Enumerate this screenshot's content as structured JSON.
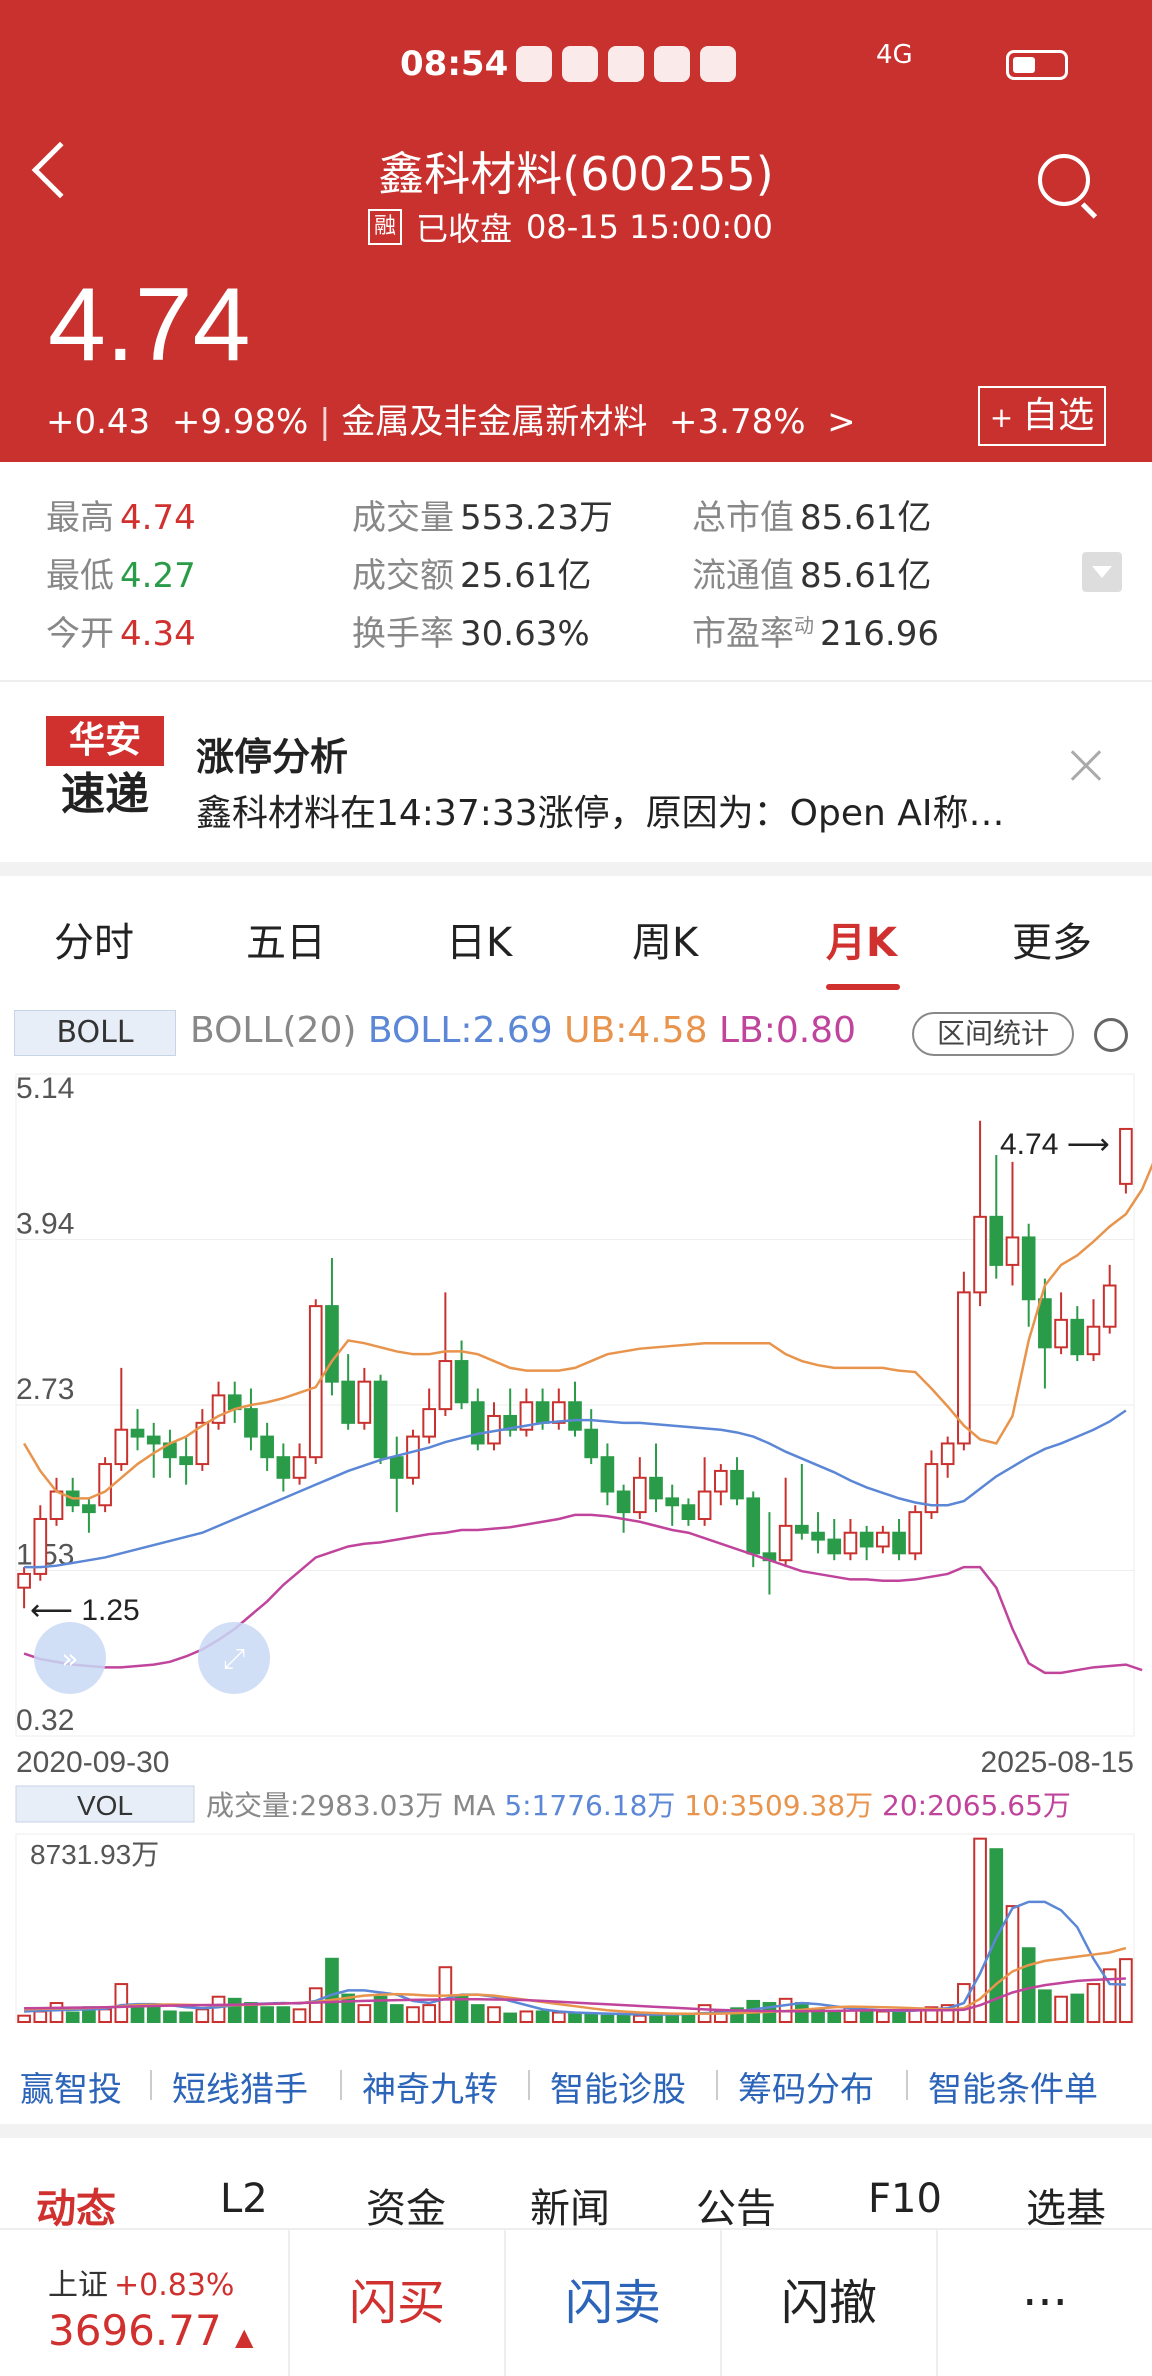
{
  "status_bar": {
    "time": "08:54",
    "net": "4G"
  },
  "header": {
    "title": "鑫科材料(600255)",
    "tag": "融",
    "status": "已收盘",
    "datetime": "08-15 15:00:00",
    "price": "4.74",
    "change": "+0.43",
    "change_pct": "+9.98%",
    "sector": "金属及非金属新材料",
    "sector_pct": "+3.78%",
    "add_label": "自选",
    "colors": {
      "bg": "#c8312e"
    }
  },
  "stats": {
    "high_label": "最高",
    "high": "4.74",
    "low_label": "最低",
    "low": "4.27",
    "open_label": "今开",
    "open": "4.34",
    "vol_label": "成交量",
    "vol": "553.23万",
    "amt_label": "成交额",
    "amt": "25.61亿",
    "turn_label": "换手率",
    "turn": "30.63%",
    "mcap_label": "总市值",
    "mcap": "85.61亿",
    "float_label": "流通值",
    "float": "85.61亿",
    "pe_label": "市盈率",
    "pe_sup": "动",
    "pe": "216.96"
  },
  "news": {
    "logo_top": "华安",
    "logo_bottom": "速递",
    "title": "涨停分析",
    "body": "鑫科材料在14:37:33涨停，原因为：Open AI称…"
  },
  "tabs": [
    "分时",
    "五日",
    "日K",
    "周K",
    "月K",
    "更多"
  ],
  "active_tab": "月K",
  "indicator": {
    "tag": "BOLL",
    "name": "BOLL(20)",
    "boll": "BOLL:2.69",
    "ub": "UB:4.58",
    "lb": "LB:0.80",
    "range_button": "区间统计"
  },
  "chart_data": {
    "type": "candlestick",
    "y_ticks": [
      "5.14",
      "3.94",
      "2.73",
      "1.53",
      "0.32"
    ],
    "ylim": [
      0.32,
      5.14
    ],
    "x_start": "2020-09-30",
    "x_end": "2025-08-15",
    "last_label": "4.74",
    "low_label": "1.25",
    "candles": [
      [
        1.4,
        1.5,
        1.55,
        1.25
      ],
      [
        1.5,
        1.9,
        2.0,
        1.45
      ],
      [
        1.9,
        2.1,
        2.2,
        1.85
      ],
      [
        2.1,
        2.0,
        2.2,
        1.95
      ],
      [
        2.0,
        1.95,
        2.05,
        1.8
      ],
      [
        2.0,
        2.3,
        2.35,
        1.95
      ],
      [
        2.3,
        2.55,
        3.0,
        2.25
      ],
      [
        2.55,
        2.5,
        2.7,
        2.4
      ],
      [
        2.5,
        2.45,
        2.6,
        2.2
      ],
      [
        2.45,
        2.35,
        2.55,
        2.2
      ],
      [
        2.35,
        2.3,
        2.5,
        2.15
      ],
      [
        2.3,
        2.6,
        2.7,
        2.25
      ],
      [
        2.6,
        2.8,
        2.9,
        2.55
      ],
      [
        2.8,
        2.7,
        2.9,
        2.6
      ],
      [
        2.7,
        2.5,
        2.85,
        2.4
      ],
      [
        2.5,
        2.35,
        2.6,
        2.25
      ],
      [
        2.35,
        2.2,
        2.45,
        2.1
      ],
      [
        2.2,
        2.35,
        2.45,
        2.15
      ],
      [
        2.35,
        3.45,
        3.5,
        2.3
      ],
      [
        3.45,
        2.9,
        3.8,
        2.8
      ],
      [
        2.9,
        2.6,
        3.1,
        2.55
      ],
      [
        2.6,
        2.9,
        3.0,
        2.55
      ],
      [
        2.9,
        2.35,
        2.95,
        2.3
      ],
      [
        2.35,
        2.2,
        2.5,
        1.95
      ],
      [
        2.2,
        2.5,
        2.55,
        2.15
      ],
      [
        2.5,
        2.7,
        2.85,
        2.45
      ],
      [
        2.7,
        3.05,
        3.55,
        2.65
      ],
      [
        3.05,
        2.75,
        3.2,
        2.7
      ],
      [
        2.75,
        2.45,
        2.85,
        2.4
      ],
      [
        2.45,
        2.65,
        2.75,
        2.4
      ],
      [
        2.65,
        2.55,
        2.85,
        2.5
      ],
      [
        2.55,
        2.75,
        2.85,
        2.5
      ],
      [
        2.75,
        2.6,
        2.85,
        2.55
      ],
      [
        2.6,
        2.75,
        2.85,
        2.55
      ],
      [
        2.75,
        2.55,
        2.9,
        2.5
      ],
      [
        2.55,
        2.35,
        2.7,
        2.3
      ],
      [
        2.35,
        2.1,
        2.45,
        2.0
      ],
      [
        2.1,
        1.95,
        2.15,
        1.8
      ],
      [
        1.95,
        2.2,
        2.35,
        1.9
      ],
      [
        2.2,
        2.05,
        2.45,
        1.95
      ],
      [
        2.05,
        2.0,
        2.15,
        1.85
      ],
      [
        2.0,
        1.9,
        2.05,
        1.85
      ],
      [
        1.9,
        2.1,
        2.35,
        1.85
      ],
      [
        2.1,
        2.25,
        2.3,
        2.0
      ],
      [
        2.25,
        2.05,
        2.35,
        2.0
      ],
      [
        2.05,
        1.65,
        2.1,
        1.55
      ],
      [
        1.65,
        1.6,
        1.95,
        1.35
      ],
      [
        1.6,
        1.85,
        2.2,
        1.55
      ],
      [
        1.85,
        1.8,
        2.3,
        1.75
      ],
      [
        1.8,
        1.75,
        1.95,
        1.65
      ],
      [
        1.75,
        1.65,
        1.9,
        1.6
      ],
      [
        1.65,
        1.8,
        1.9,
        1.6
      ],
      [
        1.8,
        1.7,
        1.85,
        1.6
      ],
      [
        1.7,
        1.8,
        1.85,
        1.65
      ],
      [
        1.8,
        1.65,
        1.9,
        1.6
      ],
      [
        1.65,
        1.95,
        2.0,
        1.6
      ],
      [
        1.95,
        2.3,
        2.4,
        1.9
      ],
      [
        2.3,
        2.45,
        2.5,
        2.2
      ],
      [
        2.45,
        3.55,
        3.7,
        2.4
      ],
      [
        3.55,
        4.1,
        4.8,
        3.45
      ],
      [
        4.1,
        3.75,
        4.55,
        3.65
      ],
      [
        3.75,
        3.95,
        4.5,
        3.6
      ],
      [
        3.95,
        3.5,
        4.05,
        3.3
      ],
      [
        3.5,
        3.15,
        3.65,
        2.85
      ],
      [
        3.15,
        3.35,
        3.55,
        3.1
      ],
      [
        3.35,
        3.1,
        3.45,
        3.05
      ],
      [
        3.1,
        3.3,
        3.5,
        3.05
      ],
      [
        3.3,
        3.6,
        3.75,
        3.25
      ],
      [
        4.34,
        4.74,
        4.74,
        4.27
      ]
    ],
    "boll_line": [
      1.55,
      1.55,
      1.56,
      1.58,
      1.6,
      1.62,
      1.65,
      1.68,
      1.71,
      1.74,
      1.77,
      1.8,
      1.85,
      1.9,
      1.95,
      2.0,
      2.05,
      2.1,
      2.15,
      2.2,
      2.25,
      2.29,
      2.33,
      2.36,
      2.39,
      2.42,
      2.46,
      2.49,
      2.52,
      2.54,
      2.56,
      2.58,
      2.6,
      2.61,
      2.62,
      2.62,
      2.61,
      2.6,
      2.6,
      2.59,
      2.58,
      2.57,
      2.56,
      2.55,
      2.53,
      2.5,
      2.45,
      2.39,
      2.34,
      2.29,
      2.24,
      2.18,
      2.13,
      2.09,
      2.05,
      2.02,
      2.0,
      2.0,
      2.03,
      2.12,
      2.21,
      2.28,
      2.35,
      2.41,
      2.45,
      2.5,
      2.55,
      2.61,
      2.69
    ],
    "ub_line": [
      2.45,
      2.25,
      2.1,
      2.05,
      2.05,
      2.1,
      2.2,
      2.3,
      2.38,
      2.45,
      2.5,
      2.58,
      2.65,
      2.7,
      2.73,
      2.75,
      2.78,
      2.82,
      2.86,
      3.05,
      3.2,
      3.18,
      3.15,
      3.12,
      3.1,
      3.1,
      3.12,
      3.12,
      3.1,
      3.05,
      3.0,
      2.98,
      2.98,
      2.98,
      3.0,
      3.05,
      3.1,
      3.12,
      3.14,
      3.15,
      3.16,
      3.17,
      3.18,
      3.18,
      3.18,
      3.18,
      3.18,
      3.1,
      3.05,
      3.02,
      3.0,
      3.0,
      3.0,
      3.0,
      2.98,
      2.97,
      2.85,
      2.72,
      2.58,
      2.48,
      2.45,
      2.65,
      3.2,
      3.6,
      3.75,
      3.82,
      3.92,
      4.03,
      4.12,
      4.3,
      4.58
    ],
    "lb_line": [
      0.92,
      0.88,
      0.86,
      0.84,
      0.83,
      0.82,
      0.82,
      0.83,
      0.84,
      0.86,
      0.9,
      0.95,
      1.02,
      1.1,
      1.2,
      1.3,
      1.42,
      1.52,
      1.62,
      1.66,
      1.7,
      1.72,
      1.73,
      1.75,
      1.77,
      1.79,
      1.8,
      1.82,
      1.82,
      1.83,
      1.84,
      1.86,
      1.88,
      1.9,
      1.93,
      1.93,
      1.92,
      1.9,
      1.88,
      1.85,
      1.82,
      1.8,
      1.76,
      1.72,
      1.68,
      1.64,
      1.6,
      1.56,
      1.52,
      1.5,
      1.48,
      1.46,
      1.46,
      1.45,
      1.45,
      1.46,
      1.48,
      1.5,
      1.55,
      1.55,
      1.4,
      1.1,
      0.85,
      0.78,
      0.78,
      0.8,
      0.82,
      0.83,
      0.84,
      0.8
    ],
    "volume_panel": {
      "tag": "VOL",
      "vol_text": "成交量:2983.03万",
      "ma_label": "MA",
      "ma5": "5:1776.18万",
      "ma10": "10:3509.38万",
      "ma20": "20:2065.65万",
      "max_label": "8731.93万",
      "volumes": [
        300,
        500,
        900,
        450,
        700,
        600,
        1800,
        700,
        700,
        500,
        450,
        600,
        1200,
        1100,
        900,
        700,
        700,
        600,
        1600,
        3000,
        1300,
        800,
        1200,
        800,
        700,
        800,
        2600,
        1200,
        800,
        700,
        400,
        500,
        500,
        450,
        400,
        400,
        300,
        350,
        300,
        400,
        400,
        350,
        800,
        500,
        650,
        1000,
        900,
        1100,
        900,
        600,
        500,
        700,
        550,
        500,
        450,
        550,
        700,
        800,
        1800,
        8700,
        8200,
        5500,
        3500,
        1500,
        1200,
        1300,
        1800,
        2500,
        2983
      ],
      "ma5_line": [
        500,
        540,
        560,
        580,
        600,
        620,
        800,
        850,
        850,
        800,
        700,
        650,
        700,
        800,
        850,
        880,
        900,
        880,
        1000,
        1300,
        1500,
        1500,
        1400,
        1300,
        1000,
        900,
        1100,
        1300,
        1300,
        1200,
        1000,
        800,
        600,
        500,
        450,
        420,
        400,
        380,
        360,
        350,
        360,
        380,
        420,
        450,
        500,
        600,
        700,
        800,
        900,
        850,
        750,
        650,
        600,
        550,
        520,
        540,
        600,
        650,
        900,
        2300,
        4000,
        5400,
        5700,
        5700,
        5300,
        4500,
        3000,
        1800,
        1776
      ],
      "ma10_line": [
        600,
        620,
        640,
        650,
        670,
        690,
        750,
        800,
        820,
        830,
        820,
        800,
        790,
        800,
        820,
        850,
        880,
        900,
        950,
        1050,
        1150,
        1250,
        1300,
        1320,
        1300,
        1250,
        1250,
        1280,
        1300,
        1250,
        1150,
        1050,
        950,
        850,
        750,
        650,
        560,
        500,
        450,
        420,
        400,
        390,
        390,
        400,
        420,
        450,
        480,
        520,
        580,
        640,
        700,
        730,
        720,
        700,
        680,
        650,
        620,
        600,
        650,
        1100,
        1800,
        2400,
        2700,
        2900,
        3000,
        3100,
        3200,
        3300,
        3509
      ],
      "ma20_line": [
        650,
        660,
        670,
        680,
        690,
        700,
        720,
        740,
        760,
        780,
        790,
        800,
        810,
        820,
        840,
        860,
        880,
        900,
        920,
        950,
        980,
        1000,
        1020,
        1040,
        1050,
        1060,
        1070,
        1080,
        1080,
        1070,
        1060,
        1040,
        1000,
        960,
        920,
        880,
        840,
        800,
        760,
        720,
        680,
        640,
        600,
        570,
        550,
        530,
        520,
        510,
        510,
        520,
        530,
        540,
        550,
        560,
        560,
        560,
        560,
        560,
        580,
        800,
        1100,
        1400,
        1600,
        1750,
        1850,
        1950,
        2000,
        2030,
        2065
      ]
    }
  },
  "quick_links": [
    "赢智投",
    "短线猎手",
    "神奇九转",
    "智能诊股",
    "筹码分布",
    "智能条件单"
  ],
  "bottom_tabs": [
    "动态",
    "L2",
    "资金",
    "新闻",
    "公告",
    "F10",
    "选基"
  ],
  "active_bottom_tab": "动态",
  "footer": {
    "index_name": "上证",
    "index_pct": "+0.83%",
    "index_value": "3696.77",
    "buy": "闪买",
    "sell": "闪卖",
    "cancel": "闪撤",
    "more": "···"
  }
}
